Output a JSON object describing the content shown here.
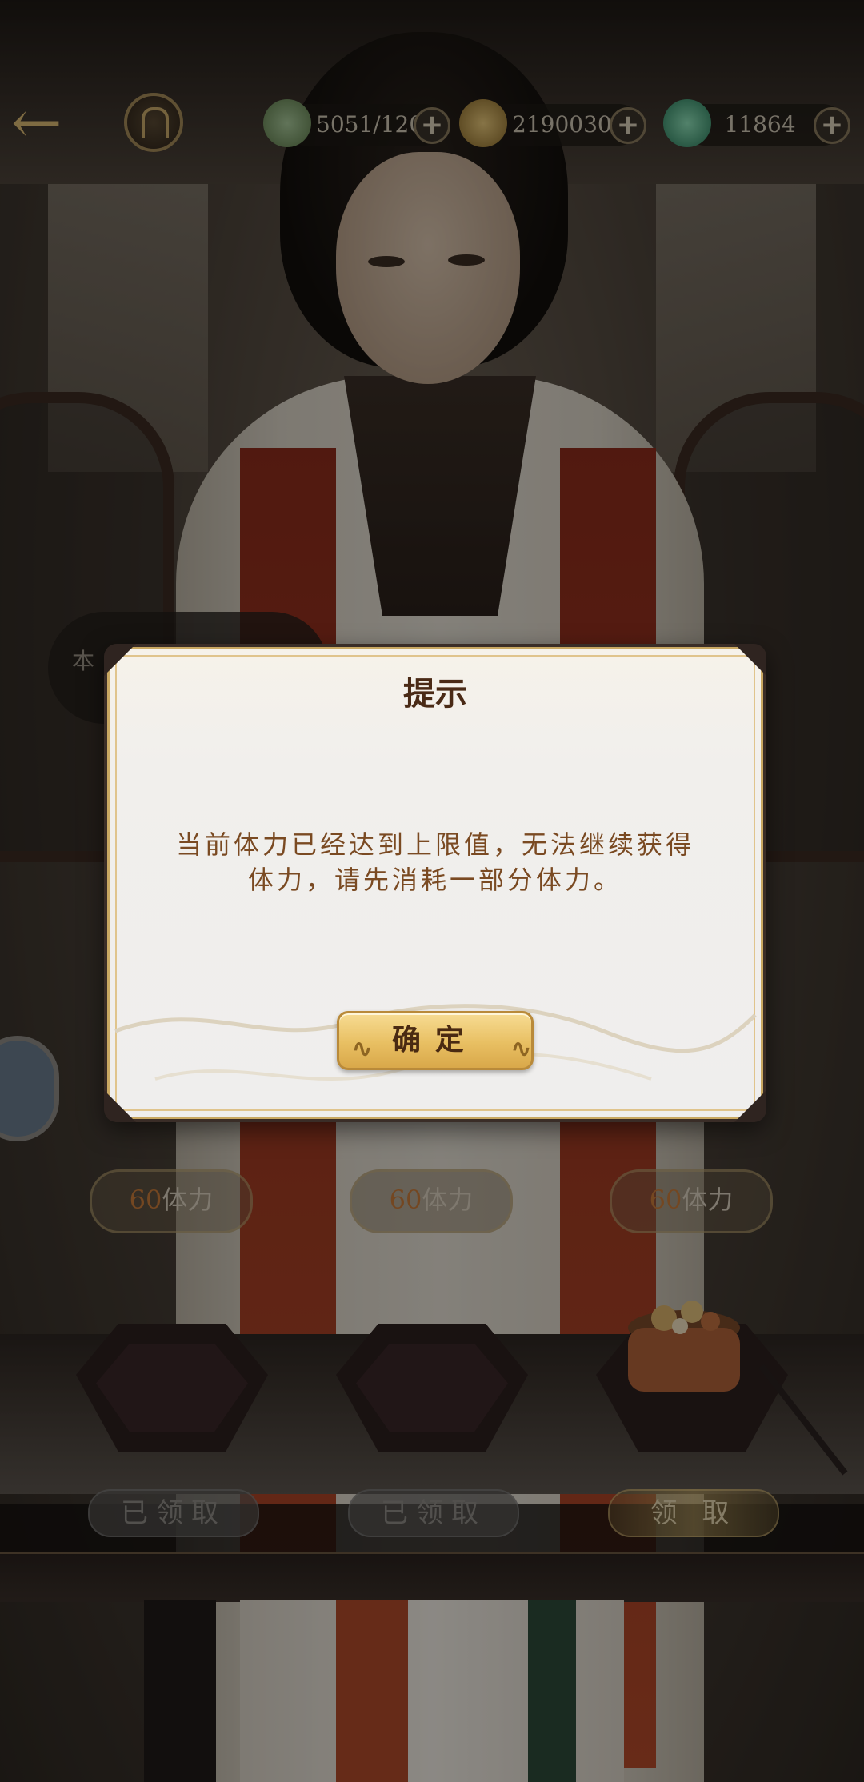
{
  "topbar": {
    "stamina": "5051/120",
    "coins": "21900305",
    "jade": "11864",
    "plus": "+"
  },
  "side_tab": {
    "label": "本"
  },
  "dialog": {
    "title": "提示",
    "message": "当前体力已经达到上限值，无法继续获得体力，请先消耗一部分体力。",
    "confirm_label": "确定"
  },
  "rewards": [
    {
      "amount": "60",
      "unit": "体力",
      "status": "已领取",
      "state": "claimed"
    },
    {
      "amount": "60",
      "unit": "体力",
      "status": "已领取",
      "state": "claimed"
    },
    {
      "amount": "60",
      "unit": "体力",
      "status": "领 取",
      "state": "available"
    }
  ],
  "icons": {
    "back": "back-arrow-icon",
    "home": "home-gate-icon",
    "stamina": "leaf-icon",
    "coins": "copper-coin-icon",
    "jade": "jade-icon"
  },
  "colors": {
    "accent_gold": "#e8bf62",
    "dialog_text": "#7a4a22",
    "title_text": "#4a2a16",
    "stamina_number": "#c87a3a"
  }
}
